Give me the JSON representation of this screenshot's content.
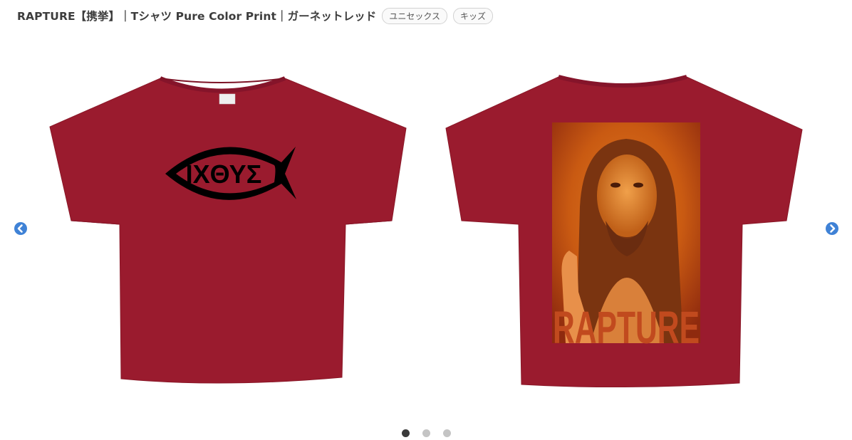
{
  "header": {
    "title": "RAPTURE【携挙】｜Tシャツ Pure Color Print｜ガーネットレッド",
    "tags": [
      "ユニセックス",
      "キッズ"
    ]
  },
  "gallery": {
    "shirt_color": "#9a1b2e",
    "front_print": {
      "text": "ΙΧΘΥΣ",
      "icon": "ichthys-fish-icon"
    },
    "back_print": {
      "text": "RAPTURE",
      "icon": "jesus-portrait-image"
    },
    "prev_icon": "chevron-left-icon",
    "next_icon": "chevron-right-icon",
    "slides": 3,
    "active_slide": 1
  },
  "colors": {
    "shirt": "#9a1b2e",
    "nav_arrow": "#3f82d6",
    "dot_active": "#3a3a3a",
    "dot_inactive": "#c4c4c4"
  }
}
